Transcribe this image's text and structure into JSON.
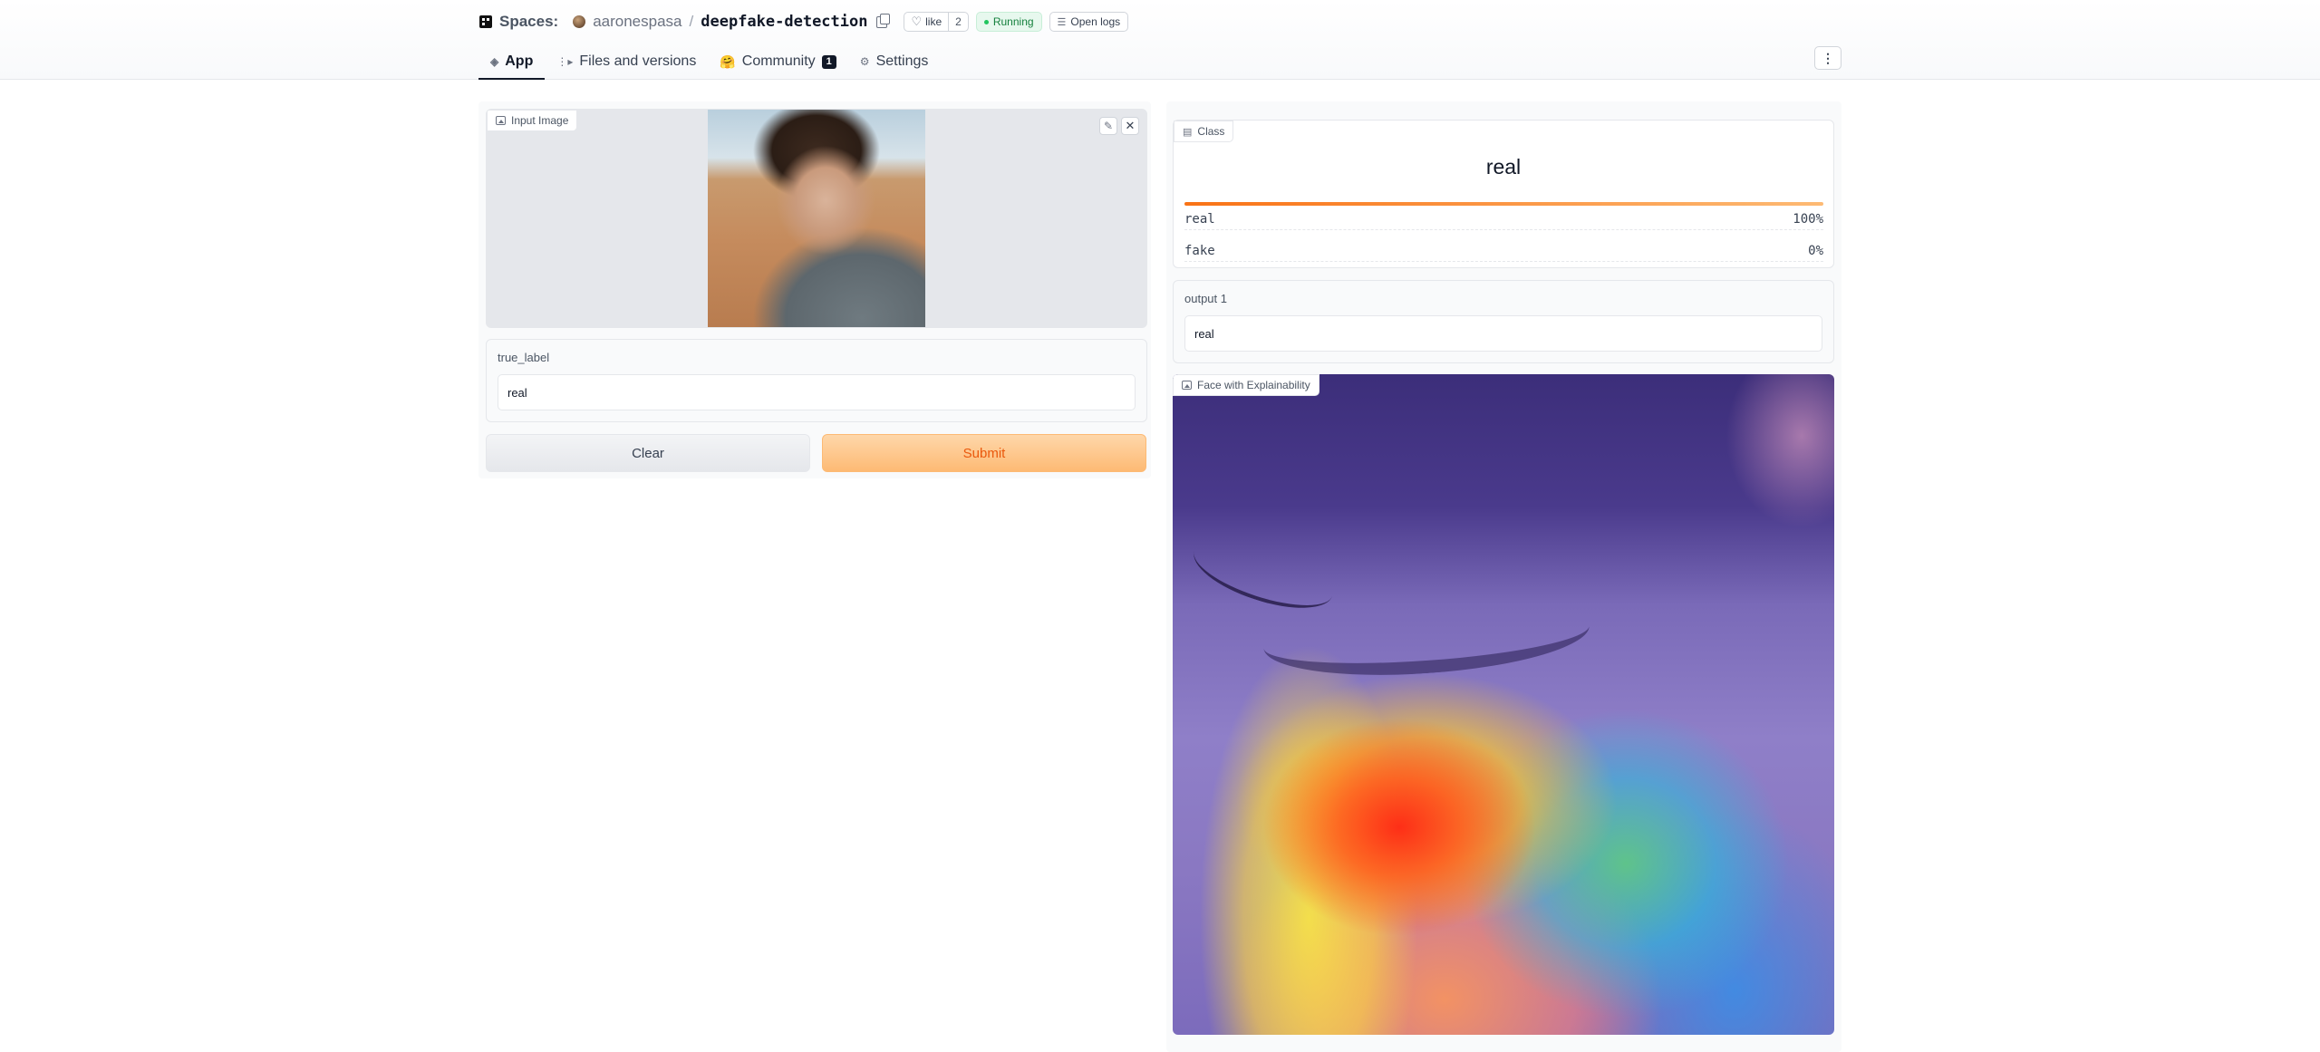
{
  "header": {
    "spaces_label": "Spaces:",
    "owner": "aaronespasa",
    "separator": "/",
    "repo": "deepfake-detection",
    "like_label": "like",
    "like_count": "2",
    "status": "Running",
    "logs_label": "Open logs"
  },
  "tabs": [
    {
      "label": "App",
      "icon": "cube-icon",
      "active": true
    },
    {
      "label": "Files and versions",
      "icon": "files-icon"
    },
    {
      "label": "Community",
      "icon": "hug-icon",
      "badge": "1"
    },
    {
      "label": "Settings",
      "icon": "gear-icon"
    }
  ],
  "left": {
    "input_image_label": "Input Image",
    "true_label": {
      "label": "true_label",
      "value": "real"
    },
    "clear_label": "Clear",
    "submit_label": "Submit"
  },
  "right": {
    "class_label": "Class",
    "predicted": "real",
    "confidences": [
      {
        "label": "real",
        "value": "100%",
        "fraction": 1.0
      },
      {
        "label": "fake",
        "value": "0%",
        "fraction": 0.0
      }
    ],
    "output1": {
      "label": "output 1",
      "value": "real"
    },
    "explain_label": "Face with Explainability"
  },
  "colors": {
    "accent": "#f97316",
    "submit_bg": "#fdba74",
    "running": "#15803d"
  }
}
